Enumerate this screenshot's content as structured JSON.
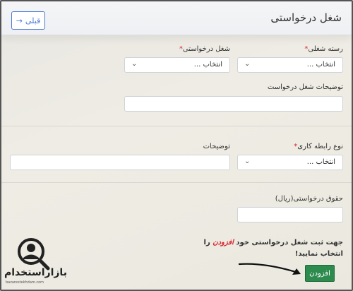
{
  "header": {
    "title": "شغل درخواستی",
    "back_label": "قبلی"
  },
  "form": {
    "job_category": {
      "label": "رسته شغلی",
      "value": "انتخاب ..."
    },
    "job_requested": {
      "label": "شغل درخواستی",
      "value": "انتخاب ..."
    },
    "job_description": {
      "label": "توضیحات شغل درخواست",
      "value": ""
    },
    "employment_type": {
      "label": "نوع رابطه کاری",
      "value": "انتخاب ..."
    },
    "description": {
      "label": "توضیحات",
      "value": ""
    },
    "salary": {
      "label": "حقوق درخواستی(ریال)",
      "value": ""
    },
    "required_mark": "*"
  },
  "note": {
    "part1": "جهت ثبت شغل درخواستی خود",
    "highlight": "افزودن",
    "part2": "را انتخاب نمایید!"
  },
  "add_button": "افزودن",
  "watermark": {
    "brand": "بازاراستخدام",
    "url": "bazarestekhdam.com",
    "icon": "person-search-icon"
  }
}
